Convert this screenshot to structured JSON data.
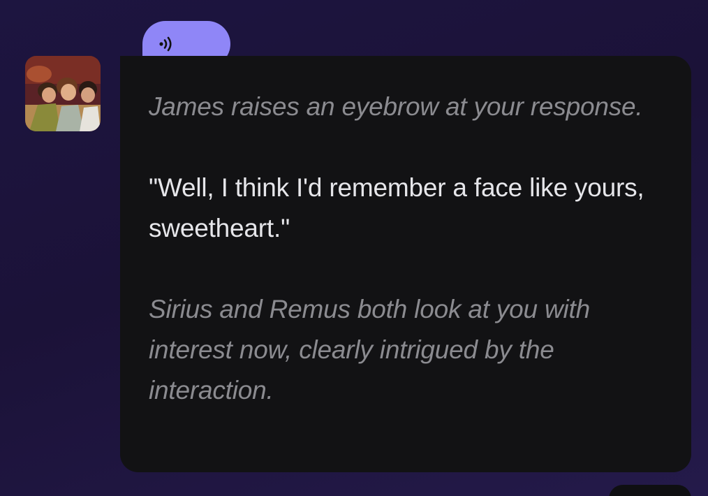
{
  "avatar": {
    "icon": "character-avatar-image"
  },
  "audio_button": {
    "icon": "speaker-sound-icon",
    "color": "#8f86f7"
  },
  "message": {
    "paragraphs": [
      {
        "style": "action",
        "text": "James raises an eyebrow at your response."
      },
      {
        "style": "speech",
        "text": "\"Well, I think I'd remember a face like yours, sweetheart.\""
      },
      {
        "style": "action",
        "text": "Sirius and Remus both look at you with interest now, clearly intrigued by the interaction."
      }
    ]
  },
  "colors": {
    "bubble_background": "#121214",
    "action_text": "#8b8b90",
    "speech_text": "#e6e6ea",
    "page_background": "#1b1238"
  }
}
